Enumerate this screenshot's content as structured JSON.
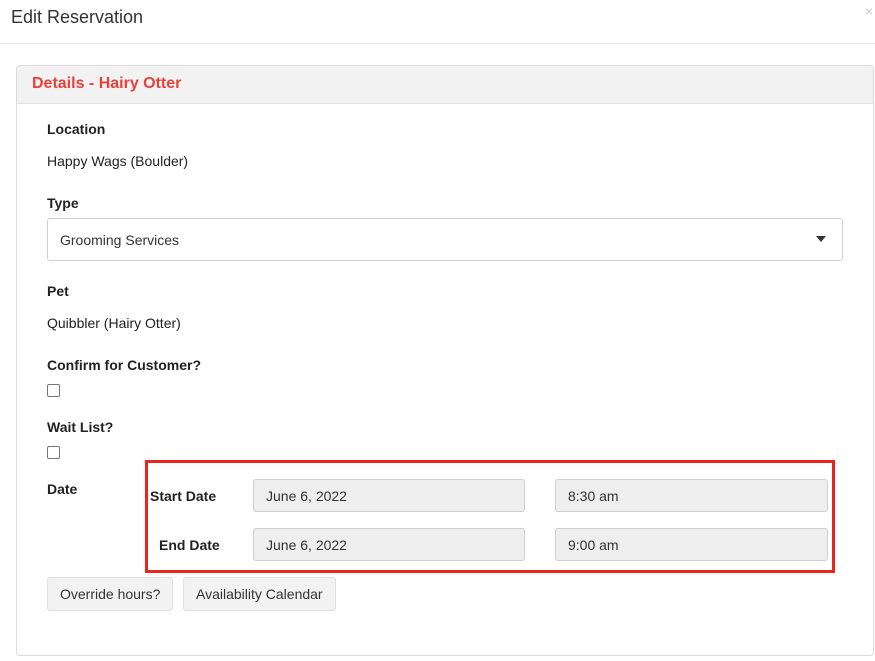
{
  "modal": {
    "title": "Edit Reservation",
    "close_glyph": "×"
  },
  "panel": {
    "title": "Details - Hairy Otter"
  },
  "form": {
    "location_label": "Location",
    "location_value": "Happy Wags (Boulder)",
    "type_label": "Type",
    "type_selected": "Grooming Services",
    "pet_label": "Pet",
    "pet_value": "Quibbler (Hairy Otter)",
    "confirm_label": "Confirm for Customer?",
    "confirm_checked": false,
    "waitlist_label": "Wait List?",
    "waitlist_checked": false,
    "date_label": "Date"
  },
  "dates": {
    "start_label": "Start Date",
    "start_date": "June 6, 2022",
    "start_time": "8:30 am",
    "end_label": "End Date",
    "end_date": "June 6, 2022",
    "end_time": "9:00 am"
  },
  "buttons": {
    "override_label": "Override hours?",
    "calendar_label": "Availability Calendar"
  },
  "colors": {
    "panel_title": "#e8413a",
    "highlight_border": "#e8261b"
  },
  "icons": {
    "close": "close-icon",
    "dropdown": "chevron-down-icon"
  }
}
